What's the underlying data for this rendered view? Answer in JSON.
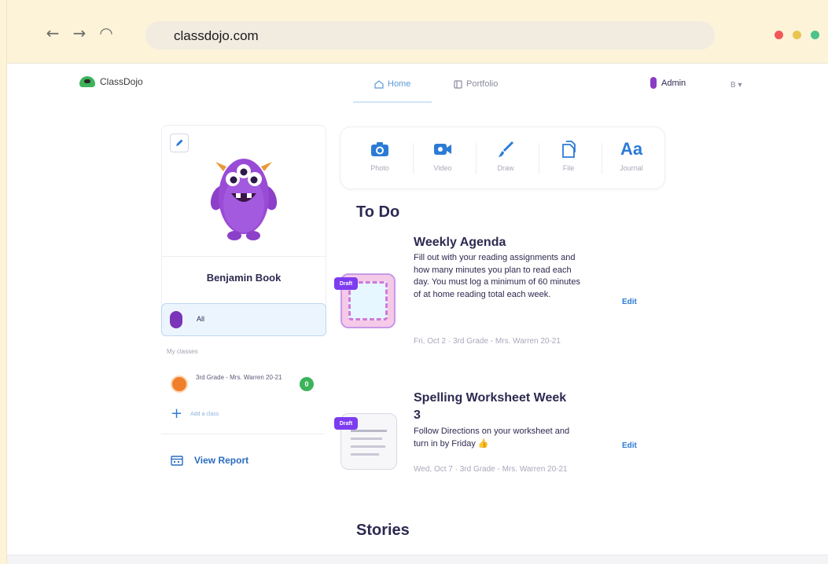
{
  "browser": {
    "url": "classdojo.com",
    "back_icon": "←",
    "forward_icon": "→",
    "reload_icon": "◠",
    "window_dots": [
      "#f25757",
      "#e8c552",
      "#4cc38a"
    ]
  },
  "header": {
    "logo_text": "ClassDojo",
    "tabs": [
      {
        "label": "Home",
        "active": true
      },
      {
        "label": "Portfolio",
        "active": false
      }
    ],
    "admin_label": "Admin",
    "language": "B ▾"
  },
  "sidebar": {
    "student_name": "Benjamin Book",
    "student_label": "All",
    "my_classes_label": "My classes",
    "classes": [
      {
        "name": "3rd Grade - Mrs. Warren 20-21",
        "badge": "0"
      }
    ],
    "add_class_label": "Add a class",
    "view_report_label": "View Report"
  },
  "composer": {
    "tools": [
      {
        "label": "Photo",
        "icon": "camera-icon"
      },
      {
        "label": "Video",
        "icon": "video-icon"
      },
      {
        "label": "Draw",
        "icon": "brush-icon"
      },
      {
        "label": "File",
        "icon": "file-icon"
      },
      {
        "label": "Journal",
        "icon": "journal-icon",
        "glyph": "Aa"
      }
    ]
  },
  "todo": {
    "title": "To Do",
    "items": [
      {
        "title": "Weekly Agenda",
        "badge": "Draft",
        "description": "Fill out with your reading assignments and how many minutes you plan to read each day. You must log a minimum of 60 minutes of at home reading total each week.",
        "meta": "Fri, Oct 2 · 3rd Grade - Mrs. Warren 20-21",
        "edit_label": "Edit"
      },
      {
        "title": "Spelling Worksheet Week 3",
        "badge": "Draft",
        "description": "Follow Directions on your worksheet and turn in by Friday 👍",
        "meta": "Wed, Oct 7 · 3rd Grade - Mrs. Warren 20-21",
        "edit_label": "Edit"
      }
    ]
  },
  "stories": {
    "title": "Stories"
  },
  "colors": {
    "accent": "#2b7bd6",
    "draft": "#7d3cf0",
    "frame": "#fdf3d9"
  }
}
